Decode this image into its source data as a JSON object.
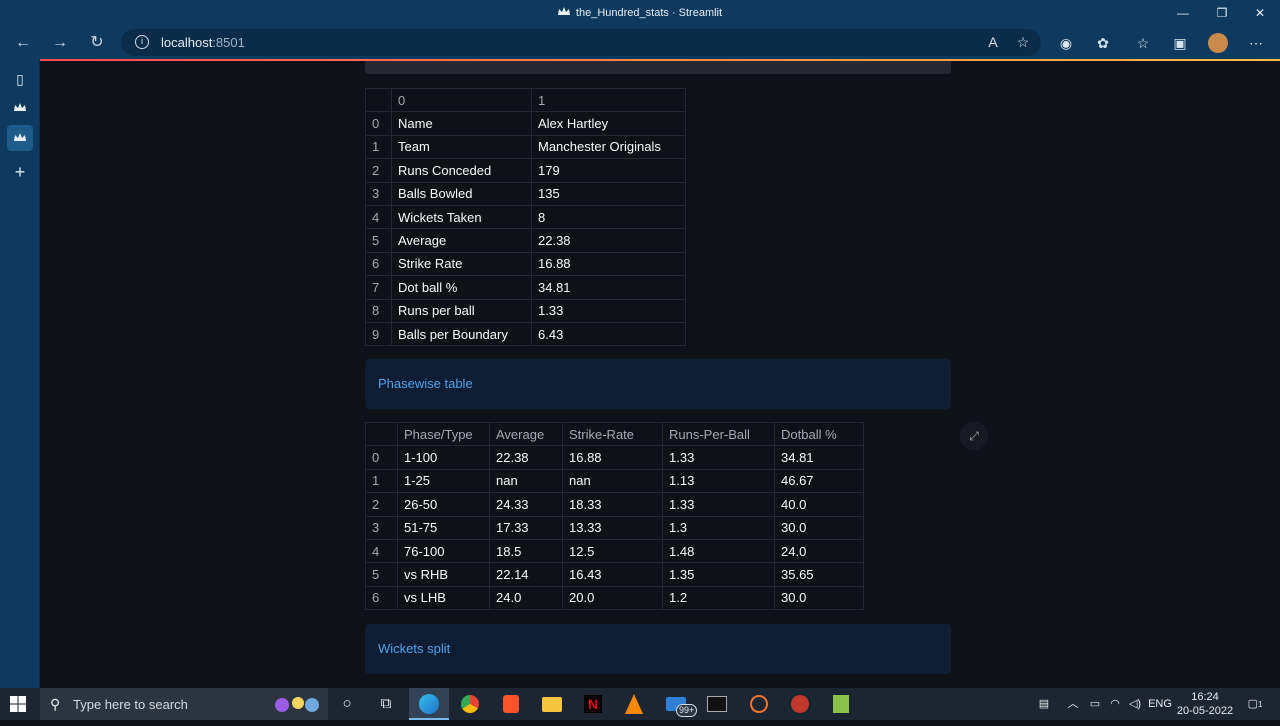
{
  "window": {
    "title": "the_Hundred_stats · Streamlit",
    "minimize": "—",
    "restore": "❐",
    "close": "✕"
  },
  "browser": {
    "url_host": "localhost",
    "url_port": ":8501",
    "back_icon": "arrow-left-icon",
    "forward_icon": "arrow-right-icon",
    "refresh_icon": "refresh-icon"
  },
  "stats_table": {
    "headers": [
      "",
      "0",
      "1"
    ],
    "rows": [
      [
        "0",
        "Name",
        "Alex Hartley"
      ],
      [
        "1",
        "Team",
        "Manchester Originals"
      ],
      [
        "2",
        "Runs Conceded",
        "179"
      ],
      [
        "3",
        "Balls Bowled",
        "135"
      ],
      [
        "4",
        "Wickets Taken",
        "8"
      ],
      [
        "5",
        "Average",
        "22.38"
      ],
      [
        "6",
        "Strike Rate",
        "16.88"
      ],
      [
        "7",
        "Dot ball %",
        "34.81"
      ],
      [
        "8",
        "Runs per ball",
        "1.33"
      ],
      [
        "9",
        "Balls per Boundary",
        "6.43"
      ]
    ]
  },
  "phasewise_expander": {
    "label": "Phasewise table"
  },
  "phase_table": {
    "headers": [
      "",
      "Phase/Type",
      "Average",
      "Strike-Rate",
      "Runs-Per-Ball",
      "Dotball %"
    ],
    "rows": [
      [
        "0",
        "1-100",
        "22.38",
        "16.88",
        "1.33",
        "34.81"
      ],
      [
        "1",
        "1-25",
        "nan",
        "nan",
        "1.13",
        "46.67"
      ],
      [
        "2",
        "26-50",
        "24.33",
        "18.33",
        "1.33",
        "40.0"
      ],
      [
        "3",
        "51-75",
        "17.33",
        "13.33",
        "1.3",
        "30.0"
      ],
      [
        "4",
        "76-100",
        "18.5",
        "12.5",
        "1.48",
        "24.0"
      ],
      [
        "5",
        "vs RHB",
        "22.14",
        "16.43",
        "1.35",
        "35.65"
      ],
      [
        "6",
        "vs LHB",
        "24.0",
        "20.0",
        "1.2",
        "30.0"
      ]
    ]
  },
  "wickets_expander": {
    "label": "Wickets split"
  },
  "taskbar": {
    "search_placeholder": "Type here to search",
    "mail_badge": "99+",
    "language": "ENG",
    "time": "16:24",
    "date": "20-05-2022",
    "notification_count": "1"
  },
  "colors": {
    "accent_red": "#ff4b4b",
    "accent_yellow": "#ffbd45",
    "link_blue": "#4aa3f0",
    "background": "#0e1117"
  }
}
